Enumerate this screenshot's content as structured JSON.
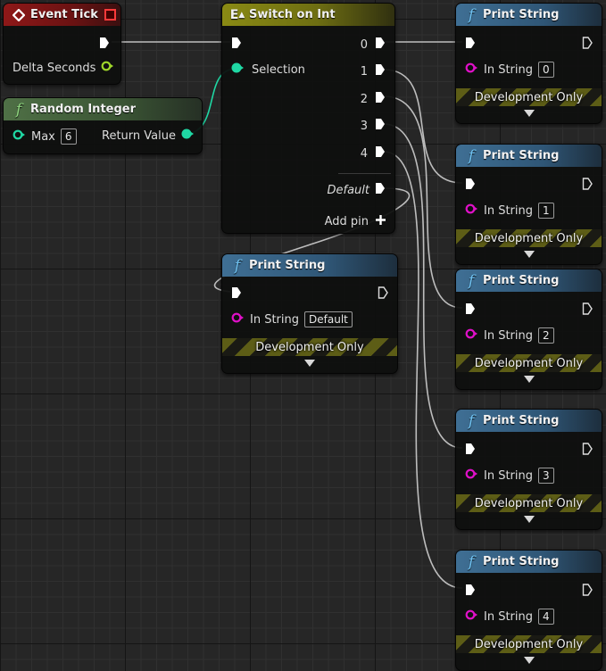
{
  "event_tick": {
    "title": "Event Tick",
    "icon": "event-diamond-icon",
    "delta_label": "Delta Seconds"
  },
  "random_integer": {
    "title": "Random Integer",
    "icon": "function-icon",
    "max_label": "Max",
    "max_value": "6",
    "return_label": "Return Value"
  },
  "switch_on_int": {
    "title": "Switch on Int",
    "icon": "switch-icon",
    "selection_label": "Selection",
    "outputs": [
      "0",
      "1",
      "2",
      "3",
      "4"
    ],
    "default_label": "Default",
    "add_pin_label": "Add pin"
  },
  "print_default": {
    "title": "Print String",
    "in_string_label": "In String",
    "in_string_value": "Default",
    "dev_label": "Development Only"
  },
  "print_nodes": [
    {
      "title": "Print String",
      "in_string_label": "In String",
      "in_string_value": "0",
      "dev_label": "Development Only"
    },
    {
      "title": "Print String",
      "in_string_label": "In String",
      "in_string_value": "1",
      "dev_label": "Development Only"
    },
    {
      "title": "Print String",
      "in_string_label": "In String",
      "in_string_value": "2",
      "dev_label": "Development Only"
    },
    {
      "title": "Print String",
      "in_string_label": "In String",
      "in_string_value": "3",
      "dev_label": "Development Only"
    },
    {
      "title": "Print String",
      "in_string_label": "In String",
      "in_string_value": "4",
      "dev_label": "Development Only"
    }
  ],
  "colors": {
    "exec_wire": "#c8c8c8",
    "int_pin": "#1fd8a4",
    "float_pin": "#9fd62a",
    "string_pin": "#e010c8",
    "event_header": "#8e1818",
    "pure_function_header": "#4f7046",
    "switch_header": "#8a8a14",
    "function_header": "#3f6f94"
  }
}
